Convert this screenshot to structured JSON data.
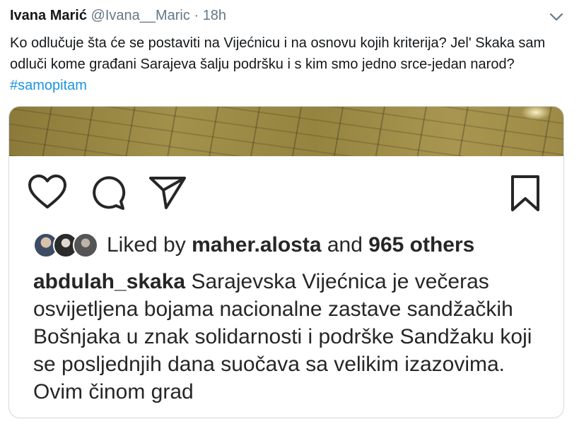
{
  "tweet": {
    "author_name": "Ivana Marić",
    "author_handle": "@Ivana__Maric",
    "separator": "·",
    "time": "18h",
    "text": "Ko odlučuje šta će se postaviti na Vijećnicu i na osnovu kojih kriterija? Jel' Skaka sam odluči kome građani Sarajeva šalju podršku i s kim smo jedno srce-jedan narod?",
    "hashtag": "#samopitam",
    "menu_icon": "chevron-down-icon"
  },
  "instagram_post": {
    "icons": [
      "heart-icon",
      "comment-icon",
      "share-icon",
      "bookmark-icon"
    ],
    "likes": {
      "prefix": "Liked by",
      "user": "maher.alosta",
      "conjunction": "and",
      "others": "965 others"
    },
    "caption": {
      "username": "abdulah_skaka",
      "text": "Sarajevska Vijećnica je večeras osvijetljena bojama nacionalne zastave sandžačkih Bošnjaka u znak solidarnosti i podrške Sandžaku koji se posljednjih dana suočava sa velikim izazovima. Ovim činom grad"
    }
  }
}
